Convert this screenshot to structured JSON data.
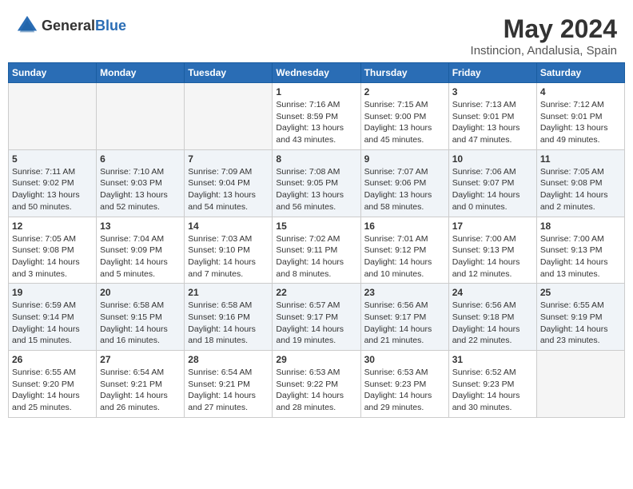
{
  "logo": {
    "general": "General",
    "blue": "Blue"
  },
  "title": "May 2024",
  "subtitle": "Instincion, Andalusia, Spain",
  "days_of_week": [
    "Sunday",
    "Monday",
    "Tuesday",
    "Wednesday",
    "Thursday",
    "Friday",
    "Saturday"
  ],
  "weeks": [
    [
      {
        "day": "",
        "info": ""
      },
      {
        "day": "",
        "info": ""
      },
      {
        "day": "",
        "info": ""
      },
      {
        "day": "1",
        "info": "Sunrise: 7:16 AM\nSunset: 8:59 PM\nDaylight: 13 hours\nand 43 minutes."
      },
      {
        "day": "2",
        "info": "Sunrise: 7:15 AM\nSunset: 9:00 PM\nDaylight: 13 hours\nand 45 minutes."
      },
      {
        "day": "3",
        "info": "Sunrise: 7:13 AM\nSunset: 9:01 PM\nDaylight: 13 hours\nand 47 minutes."
      },
      {
        "day": "4",
        "info": "Sunrise: 7:12 AM\nSunset: 9:01 PM\nDaylight: 13 hours\nand 49 minutes."
      }
    ],
    [
      {
        "day": "5",
        "info": "Sunrise: 7:11 AM\nSunset: 9:02 PM\nDaylight: 13 hours\nand 50 minutes."
      },
      {
        "day": "6",
        "info": "Sunrise: 7:10 AM\nSunset: 9:03 PM\nDaylight: 13 hours\nand 52 minutes."
      },
      {
        "day": "7",
        "info": "Sunrise: 7:09 AM\nSunset: 9:04 PM\nDaylight: 13 hours\nand 54 minutes."
      },
      {
        "day": "8",
        "info": "Sunrise: 7:08 AM\nSunset: 9:05 PM\nDaylight: 13 hours\nand 56 minutes."
      },
      {
        "day": "9",
        "info": "Sunrise: 7:07 AM\nSunset: 9:06 PM\nDaylight: 13 hours\nand 58 minutes."
      },
      {
        "day": "10",
        "info": "Sunrise: 7:06 AM\nSunset: 9:07 PM\nDaylight: 14 hours\nand 0 minutes."
      },
      {
        "day": "11",
        "info": "Sunrise: 7:05 AM\nSunset: 9:08 PM\nDaylight: 14 hours\nand 2 minutes."
      }
    ],
    [
      {
        "day": "12",
        "info": "Sunrise: 7:05 AM\nSunset: 9:08 PM\nDaylight: 14 hours\nand 3 minutes."
      },
      {
        "day": "13",
        "info": "Sunrise: 7:04 AM\nSunset: 9:09 PM\nDaylight: 14 hours\nand 5 minutes."
      },
      {
        "day": "14",
        "info": "Sunrise: 7:03 AM\nSunset: 9:10 PM\nDaylight: 14 hours\nand 7 minutes."
      },
      {
        "day": "15",
        "info": "Sunrise: 7:02 AM\nSunset: 9:11 PM\nDaylight: 14 hours\nand 8 minutes."
      },
      {
        "day": "16",
        "info": "Sunrise: 7:01 AM\nSunset: 9:12 PM\nDaylight: 14 hours\nand 10 minutes."
      },
      {
        "day": "17",
        "info": "Sunrise: 7:00 AM\nSunset: 9:13 PM\nDaylight: 14 hours\nand 12 minutes."
      },
      {
        "day": "18",
        "info": "Sunrise: 7:00 AM\nSunset: 9:13 PM\nDaylight: 14 hours\nand 13 minutes."
      }
    ],
    [
      {
        "day": "19",
        "info": "Sunrise: 6:59 AM\nSunset: 9:14 PM\nDaylight: 14 hours\nand 15 minutes."
      },
      {
        "day": "20",
        "info": "Sunrise: 6:58 AM\nSunset: 9:15 PM\nDaylight: 14 hours\nand 16 minutes."
      },
      {
        "day": "21",
        "info": "Sunrise: 6:58 AM\nSunset: 9:16 PM\nDaylight: 14 hours\nand 18 minutes."
      },
      {
        "day": "22",
        "info": "Sunrise: 6:57 AM\nSunset: 9:17 PM\nDaylight: 14 hours\nand 19 minutes."
      },
      {
        "day": "23",
        "info": "Sunrise: 6:56 AM\nSunset: 9:17 PM\nDaylight: 14 hours\nand 21 minutes."
      },
      {
        "day": "24",
        "info": "Sunrise: 6:56 AM\nSunset: 9:18 PM\nDaylight: 14 hours\nand 22 minutes."
      },
      {
        "day": "25",
        "info": "Sunrise: 6:55 AM\nSunset: 9:19 PM\nDaylight: 14 hours\nand 23 minutes."
      }
    ],
    [
      {
        "day": "26",
        "info": "Sunrise: 6:55 AM\nSunset: 9:20 PM\nDaylight: 14 hours\nand 25 minutes."
      },
      {
        "day": "27",
        "info": "Sunrise: 6:54 AM\nSunset: 9:21 PM\nDaylight: 14 hours\nand 26 minutes."
      },
      {
        "day": "28",
        "info": "Sunrise: 6:54 AM\nSunset: 9:21 PM\nDaylight: 14 hours\nand 27 minutes."
      },
      {
        "day": "29",
        "info": "Sunrise: 6:53 AM\nSunset: 9:22 PM\nDaylight: 14 hours\nand 28 minutes."
      },
      {
        "day": "30",
        "info": "Sunrise: 6:53 AM\nSunset: 9:23 PM\nDaylight: 14 hours\nand 29 minutes."
      },
      {
        "day": "31",
        "info": "Sunrise: 6:52 AM\nSunset: 9:23 PM\nDaylight: 14 hours\nand 30 minutes."
      },
      {
        "day": "",
        "info": ""
      }
    ]
  ]
}
